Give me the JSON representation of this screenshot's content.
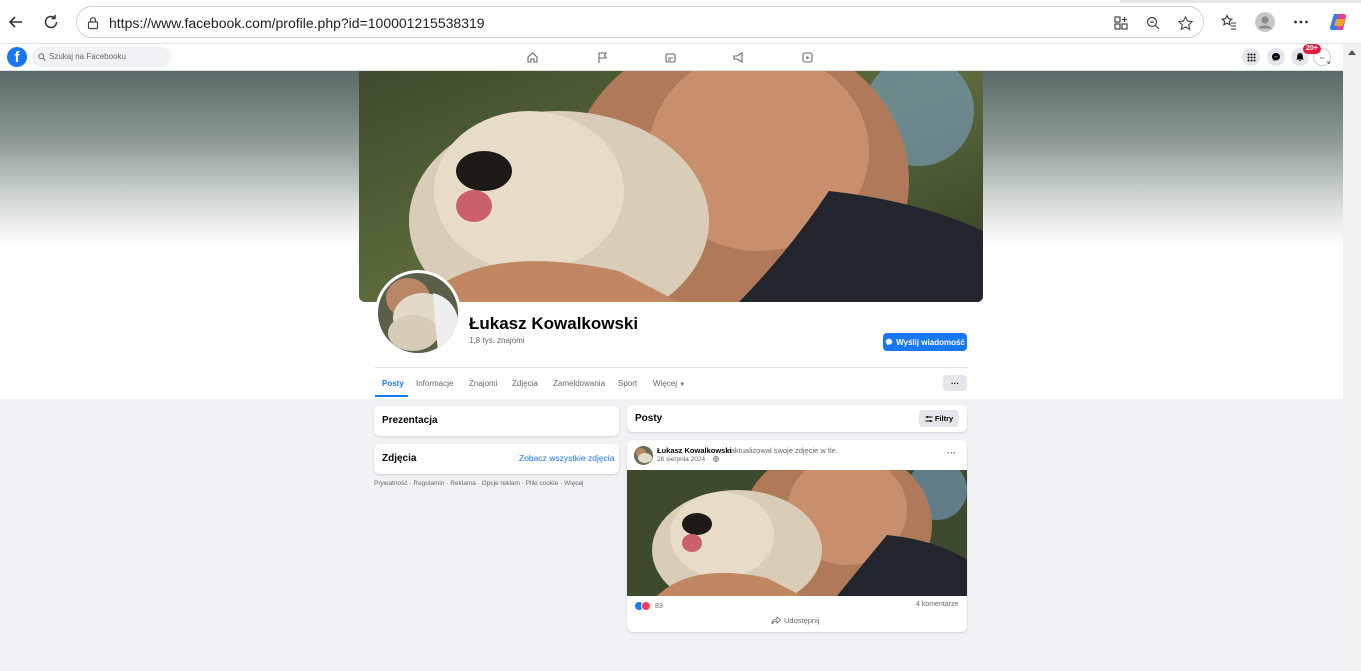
{
  "browser": {
    "url": "https://www.facebook.com/profile.php?id=100001215538319"
  },
  "fb_header": {
    "search_placeholder": "Szukaj na Facebooku",
    "notification_badge": "20+",
    "brand_color": "#1877f2"
  },
  "profile": {
    "name": "Łukasz Kowalkowski",
    "friends": "1,8 tys. znajomi",
    "message_button": "Wyślij wiadomość"
  },
  "tabs": [
    {
      "label": "Posty"
    },
    {
      "label": "Informacje"
    },
    {
      "label": "Znajomi"
    },
    {
      "label": "Zdjęcia"
    },
    {
      "label": "Zameldowania"
    },
    {
      "label": "Sport"
    },
    {
      "label": "Więcej"
    }
  ],
  "left_column": {
    "intro_title": "Prezentacja",
    "photos_title": "Zdjęcia",
    "photos_link": "Zobacz wszystkie zdjęcia",
    "footer": "Prywatność · Regulamin · Reklama · Opcje reklam · Pliki cookie · Więcej"
  },
  "posts_section": {
    "title": "Posty",
    "filter_label": "Filtry"
  },
  "post": {
    "author": "Łukasz Kowalkowski",
    "action": "zaktualizował swoje zdjęcie w tle.",
    "date": "26 sierpnia 2024 ·",
    "reaction_count": "83",
    "comments": "4 komentarze",
    "share_label": "Udostępnij"
  }
}
